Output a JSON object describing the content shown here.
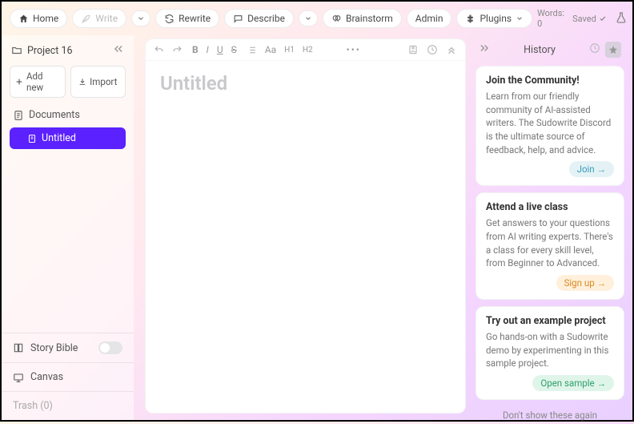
{
  "toolbar": {
    "home": "Home",
    "write": "Write",
    "rewrite": "Rewrite",
    "describe": "Describe",
    "brainstorm": "Brainstorm",
    "admin": "Admin",
    "plugins": "Plugins"
  },
  "status": {
    "words_label": "Words:",
    "words_value": "0",
    "saved": "Saved"
  },
  "sidebar": {
    "project": "Project 16",
    "add_new": "Add new",
    "import": "Import",
    "documents_label": "Documents",
    "doc_untitled": "Untitled",
    "story_bible": "Story Bible",
    "canvas": "Canvas",
    "trash": "Trash (0)"
  },
  "editor": {
    "headings": {
      "aa": "Aa",
      "h1": "H1",
      "h2": "H2"
    },
    "title_placeholder": "Untitled"
  },
  "history": {
    "title": "History",
    "cards": [
      {
        "title": "Join the Community!",
        "body": "Learn from our friendly community of AI-assisted writers. The Sudowrite Discord is the ultimate source of feedback, help, and advice.",
        "action": "Join →"
      },
      {
        "title": "Attend a live class",
        "body": "Get answers to your questions from AI writing experts. There's a class for every skill level, from Beginner to Advanced.",
        "action": "Sign up →"
      },
      {
        "title": "Try out an example project",
        "body": "Go hands-on with a Sudowrite demo by experimenting in this sample project.",
        "action": "Open sample →"
      }
    ],
    "dont_show": "Don't show these again"
  }
}
